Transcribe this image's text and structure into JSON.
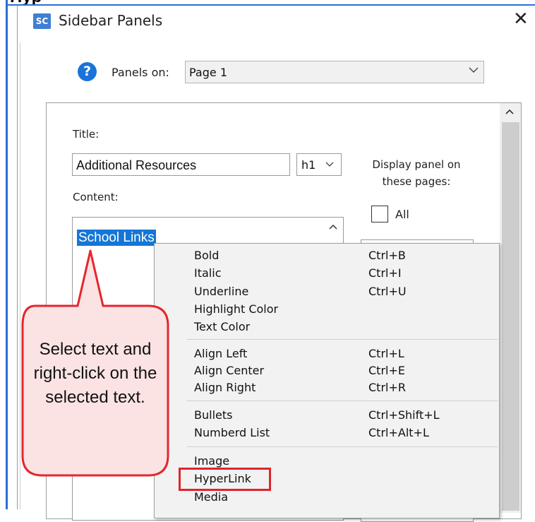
{
  "window": {
    "top_clip_text": "Hyp",
    "app_icon_text": "SC",
    "title": "Sidebar Panels",
    "close_glyph": "✕"
  },
  "panels_on": {
    "help_glyph": "?",
    "label": "Panels on:",
    "selected": "Page 1"
  },
  "form": {
    "title_label": "Title:",
    "title_value": "Additional Resources",
    "heading_value": "h1",
    "content_label": "Content:",
    "content_selected_text": "School Links",
    "display_label": "Display panel on these pages:",
    "all_label": "All"
  },
  "context_menu": {
    "groups": [
      [
        {
          "label": "Bold",
          "shortcut": "Ctrl+B"
        },
        {
          "label": "Italic",
          "shortcut": "Ctrl+I"
        },
        {
          "label": "Underline",
          "shortcut": "Ctrl+U"
        },
        {
          "label": "Highlight Color",
          "shortcut": ""
        },
        {
          "label": "Text Color",
          "shortcut": ""
        }
      ],
      [
        {
          "label": "Align Left",
          "shortcut": "Ctrl+L"
        },
        {
          "label": "Align Center",
          "shortcut": "Ctrl+E"
        },
        {
          "label": "Align Right",
          "shortcut": "Ctrl+R"
        }
      ],
      [
        {
          "label": "Bullets",
          "shortcut": "Ctrl+Shift+L"
        },
        {
          "label": "Numberd List",
          "shortcut": "Ctrl+Alt+L"
        }
      ],
      [
        {
          "label": "Image",
          "shortcut": ""
        },
        {
          "label": "HyperLink",
          "shortcut": ""
        },
        {
          "label": "Media",
          "shortcut": ""
        }
      ]
    ],
    "highlighted_item": "HyperLink"
  },
  "callout": {
    "text": "Select text and right-click on the selected text.",
    "fill_color": "#fbe3e3",
    "border_color": "#e5262c"
  },
  "colors": {
    "selection": "#1476d6",
    "accent": "#2b6fd6",
    "highlight_box": "#e0242b"
  }
}
